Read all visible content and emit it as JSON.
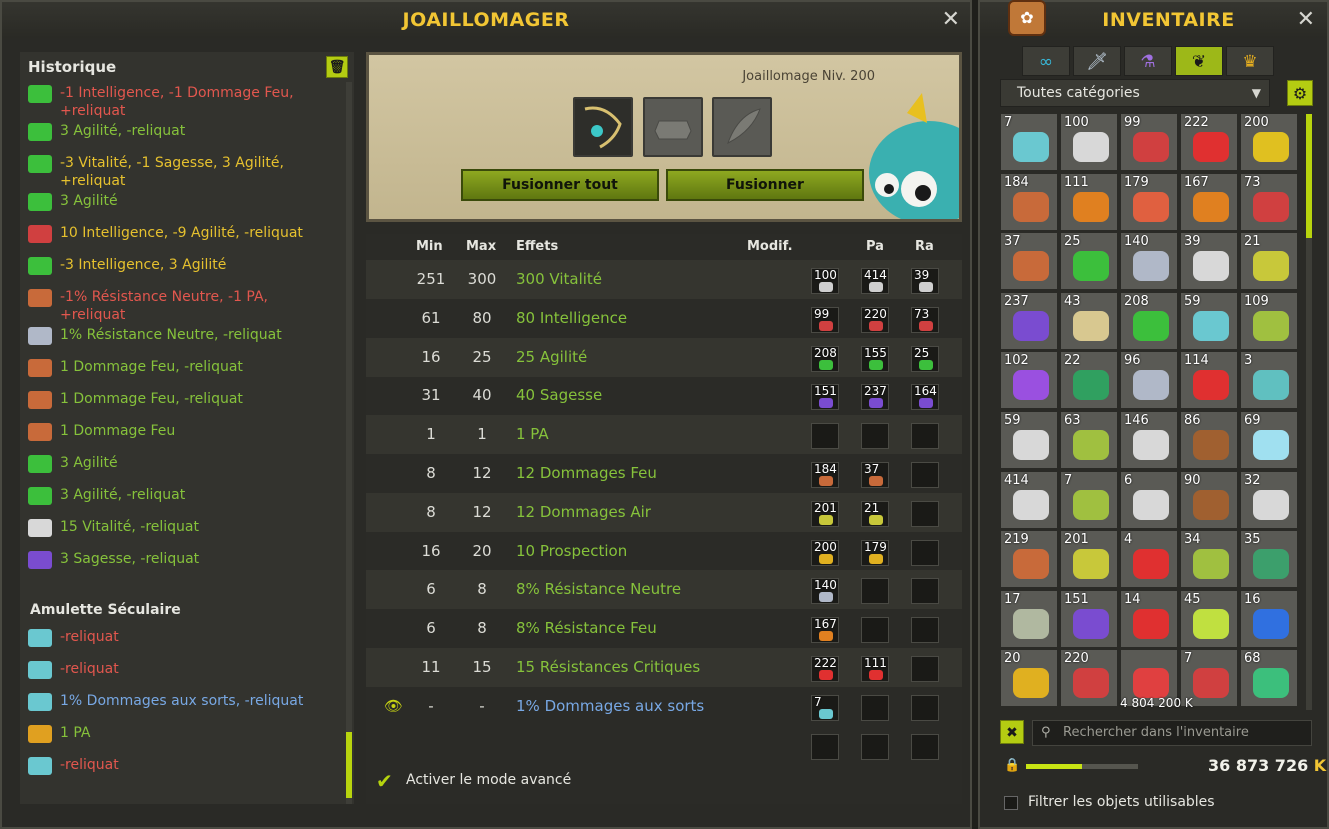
{
  "joaillomager": {
    "title": "JOAILLOMAGER",
    "close": "✕",
    "history": {
      "title": "Historique",
      "entries": [
        {
          "text": "-1 Intelligence, -1 Dommage Feu, +reliquat",
          "color": "red",
          "icon": "rune-green"
        },
        {
          "text": "3 Agilité, -reliquat",
          "color": "green",
          "icon": "rune-green"
        },
        {
          "text": "-3 Vitalité, -1 Sagesse, 3 Agilité, +reliquat",
          "color": "yellow",
          "icon": "rune-green"
        },
        {
          "text": "3 Agilité",
          "color": "green",
          "icon": "rune-green"
        },
        {
          "text": "10 Intelligence, -9 Agilité, -reliquat",
          "color": "yellow",
          "icon": "rune-red"
        },
        {
          "text": "-3 Intelligence, 3 Agilité",
          "color": "yellow",
          "icon": "rune-green"
        },
        {
          "text": "-1% Résistance Neutre, -1 PA, +reliquat",
          "color": "red",
          "icon": "rune-fire"
        },
        {
          "text": "1% Résistance Neutre, -reliquat",
          "color": "green",
          "icon": "rune-neutral"
        },
        {
          "text": "1 Dommage Feu, -reliquat",
          "color": "green",
          "icon": "rune-fire"
        },
        {
          "text": "1 Dommage Feu, -reliquat",
          "color": "green",
          "icon": "rune-fire"
        },
        {
          "text": "1 Dommage Feu",
          "color": "green",
          "icon": "rune-fire"
        },
        {
          "text": "3 Agilité",
          "color": "green",
          "icon": "rune-green"
        },
        {
          "text": "3 Agilité, -reliquat",
          "color": "green",
          "icon": "rune-green"
        },
        {
          "text": "15 Vitalité, -reliquat",
          "color": "green",
          "icon": "rune-white"
        },
        {
          "text": "3 Sagesse, -reliquat",
          "color": "green",
          "icon": "rune-purple"
        }
      ],
      "section2_title": "Amulette Séculaire",
      "entries2": [
        {
          "text": "-reliquat",
          "color": "red",
          "icon": "rune-cyan"
        },
        {
          "text": "-reliquat",
          "color": "red",
          "icon": "rune-cyan"
        },
        {
          "text": "1% Dommages aux sorts, -reliquat",
          "color": "blue",
          "icon": "rune-cyan"
        },
        {
          "text": "1 PA",
          "color": "green",
          "icon": "rune-pa"
        },
        {
          "text": "-reliquat",
          "color": "red",
          "icon": "rune-cyan"
        }
      ]
    },
    "craft": {
      "level": "Joaillomage Niv. 200",
      "fuse_all": "Fusionner tout",
      "fuse": "Fusionner"
    },
    "table": {
      "headers": {
        "min": "Min",
        "max": "Max",
        "effects": "Effets",
        "modif": "Modif.",
        "pa": "Pa",
        "ra": "Ra"
      },
      "rows": [
        {
          "min": "251",
          "max": "300",
          "effect": "300 Vitalité",
          "ba": "100",
          "pa": "414",
          "ra": "39",
          "color": "green",
          "rune": "#cfcfcf"
        },
        {
          "min": "61",
          "max": "80",
          "effect": "80 Intelligence",
          "ba": "99",
          "pa": "220",
          "ra": "73",
          "color": "green",
          "rune": "#d04040"
        },
        {
          "min": "16",
          "max": "25",
          "effect": "25 Agilité",
          "ba": "208",
          "pa": "155",
          "ra": "25",
          "color": "green",
          "rune": "#3cbf3c"
        },
        {
          "min": "31",
          "max": "40",
          "effect": "40 Sagesse",
          "ba": "151",
          "pa": "237",
          "ra": "164",
          "color": "green",
          "rune": "#7a4cd0"
        },
        {
          "min": "1",
          "max": "1",
          "effect": "1 PA",
          "ba": "",
          "pa": "",
          "ra": "",
          "color": "green",
          "rune": ""
        },
        {
          "min": "8",
          "max": "12",
          "effect": "12 Dommages Feu",
          "ba": "184",
          "pa": "37",
          "ra": "",
          "color": "green",
          "rune": "#c86a3a"
        },
        {
          "min": "8",
          "max": "12",
          "effect": "12 Dommages Air",
          "ba": "201",
          "pa": "21",
          "ra": "",
          "color": "green",
          "rune": "#c8c83a"
        },
        {
          "min": "16",
          "max": "20",
          "effect": "10 Prospection",
          "ba": "200",
          "pa": "179",
          "ra": "",
          "color": "green",
          "rune": "#e0b020"
        },
        {
          "min": "6",
          "max": "8",
          "effect": "8% Résistance Neutre",
          "ba": "140",
          "pa": "",
          "ra": "",
          "color": "green",
          "rune": "#b0b8c8"
        },
        {
          "min": "6",
          "max": "8",
          "effect": "8% Résistance Feu",
          "ba": "167",
          "pa": "",
          "ra": "",
          "color": "green",
          "rune": "#e08020"
        },
        {
          "min": "11",
          "max": "15",
          "effect": "15 Résistances Critiques",
          "ba": "222",
          "pa": "111",
          "ra": "",
          "color": "green",
          "rune": "#e03030"
        },
        {
          "min": "-",
          "max": "-",
          "effect": "1% Dommages aux sorts",
          "ba": "7",
          "pa": "",
          "ra": "",
          "color": "blue",
          "rune": "#6ac8d0"
        }
      ],
      "advanced_mode": "Activer le mode avancé"
    }
  },
  "inventory": {
    "title": "INVENTAIRE",
    "close": "✕",
    "tabs": [
      {
        "icon": "infinity-icon",
        "glyph": "∞"
      },
      {
        "icon": "weapon-icon",
        "glyph": "🗡"
      },
      {
        "icon": "potion-icon",
        "glyph": "⚗"
      },
      {
        "icon": "resource-icon",
        "glyph": "❦"
      },
      {
        "icon": "quest-icon",
        "glyph": "♛"
      }
    ],
    "category": "Toutes catégories",
    "items": [
      {
        "n": "7",
        "c": "#6ac8d0"
      },
      {
        "n": "100",
        "c": "#d8d8d8"
      },
      {
        "n": "99",
        "c": "#d04040"
      },
      {
        "n": "222",
        "c": "#e03030"
      },
      {
        "n": "200",
        "c": "#e0c020"
      },
      {
        "n": "184",
        "c": "#c86a3a"
      },
      {
        "n": "111",
        "c": "#e08020"
      },
      {
        "n": "179",
        "c": "#e06040"
      },
      {
        "n": "167",
        "c": "#e08020"
      },
      {
        "n": "73",
        "c": "#d04040"
      },
      {
        "n": "37",
        "c": "#c86a3a"
      },
      {
        "n": "25",
        "c": "#3cbf3c"
      },
      {
        "n": "140",
        "c": "#b0b8c8"
      },
      {
        "n": "39",
        "c": "#d8d8d8"
      },
      {
        "n": "21",
        "c": "#c8c83a"
      },
      {
        "n": "237",
        "c": "#7a4cd0"
      },
      {
        "n": "43",
        "c": "#d8c890"
      },
      {
        "n": "208",
        "c": "#3cbf3c"
      },
      {
        "n": "59",
        "c": "#6ac8d0"
      },
      {
        "n": "109",
        "c": "#a0c040"
      },
      {
        "n": "102",
        "c": "#9a50e0"
      },
      {
        "n": "22",
        "c": "#30a060"
      },
      {
        "n": "96",
        "c": "#b0b8c8"
      },
      {
        "n": "114",
        "c": "#e03030"
      },
      {
        "n": "3",
        "c": "#60c0c0"
      },
      {
        "n": "59",
        "c": "#d8d8d8"
      },
      {
        "n": "63",
        "c": "#a0c040"
      },
      {
        "n": "146",
        "c": "#d8d8d8"
      },
      {
        "n": "86",
        "c": "#a06030"
      },
      {
        "n": "69",
        "c": "#a0e0f0"
      },
      {
        "n": "414",
        "c": "#d8d8d8"
      },
      {
        "n": "7",
        "c": "#a0c040"
      },
      {
        "n": "6",
        "c": "#d8d8d8"
      },
      {
        "n": "90",
        "c": "#a06030"
      },
      {
        "n": "32",
        "c": "#d8d8d8"
      },
      {
        "n": "219",
        "c": "#c86a3a"
      },
      {
        "n": "201",
        "c": "#c8c83a"
      },
      {
        "n": "4",
        "c": "#e03030"
      },
      {
        "n": "34",
        "c": "#a0c040"
      },
      {
        "n": "35",
        "c": "#3c9f6c"
      },
      {
        "n": "17",
        "c": "#b0b8a0"
      },
      {
        "n": "151",
        "c": "#7a4cd0"
      },
      {
        "n": "14",
        "c": "#e03030"
      },
      {
        "n": "45",
        "c": "#c0e040"
      },
      {
        "n": "16",
        "c": "#3070e0"
      },
      {
        "n": "20",
        "c": "#e0b020"
      },
      {
        "n": "220",
        "c": "#d04040"
      },
      {
        "n": "",
        "c": "#e04040"
      },
      {
        "n": "7",
        "c": "#d04040"
      },
      {
        "n": "68",
        "c": "#3cbf7c"
      }
    ],
    "overlay_kamas": "4 804 200 K",
    "search_placeholder": "Rechercher dans l'inventaire",
    "progress": 0.5,
    "kamas": "36 873 726",
    "kamas_symbol": "K",
    "filter_label": "Filtrer les objets utilisables"
  }
}
